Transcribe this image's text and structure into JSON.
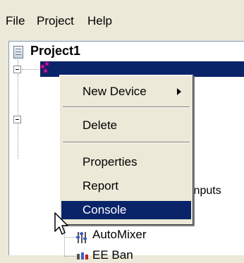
{
  "menubar": {
    "items": [
      {
        "label": "File"
      },
      {
        "label": "Project"
      },
      {
        "label": "Help"
      }
    ]
  },
  "tree": {
    "project_label": "Project1",
    "visible_fragment": "inputs",
    "automixer_label": "AutoMixer",
    "partial_label": "EE Ban"
  },
  "context_menu": {
    "items": [
      {
        "label": "New Device",
        "has_submenu": true
      },
      {
        "label": "Delete"
      },
      {
        "label": "Properties"
      },
      {
        "label": "Report"
      },
      {
        "label": "Console",
        "highlighted": true
      }
    ]
  },
  "colors": {
    "selection": "#0a246a",
    "menu_bg": "#ece9d8",
    "tree_bg": "#ffffff"
  }
}
